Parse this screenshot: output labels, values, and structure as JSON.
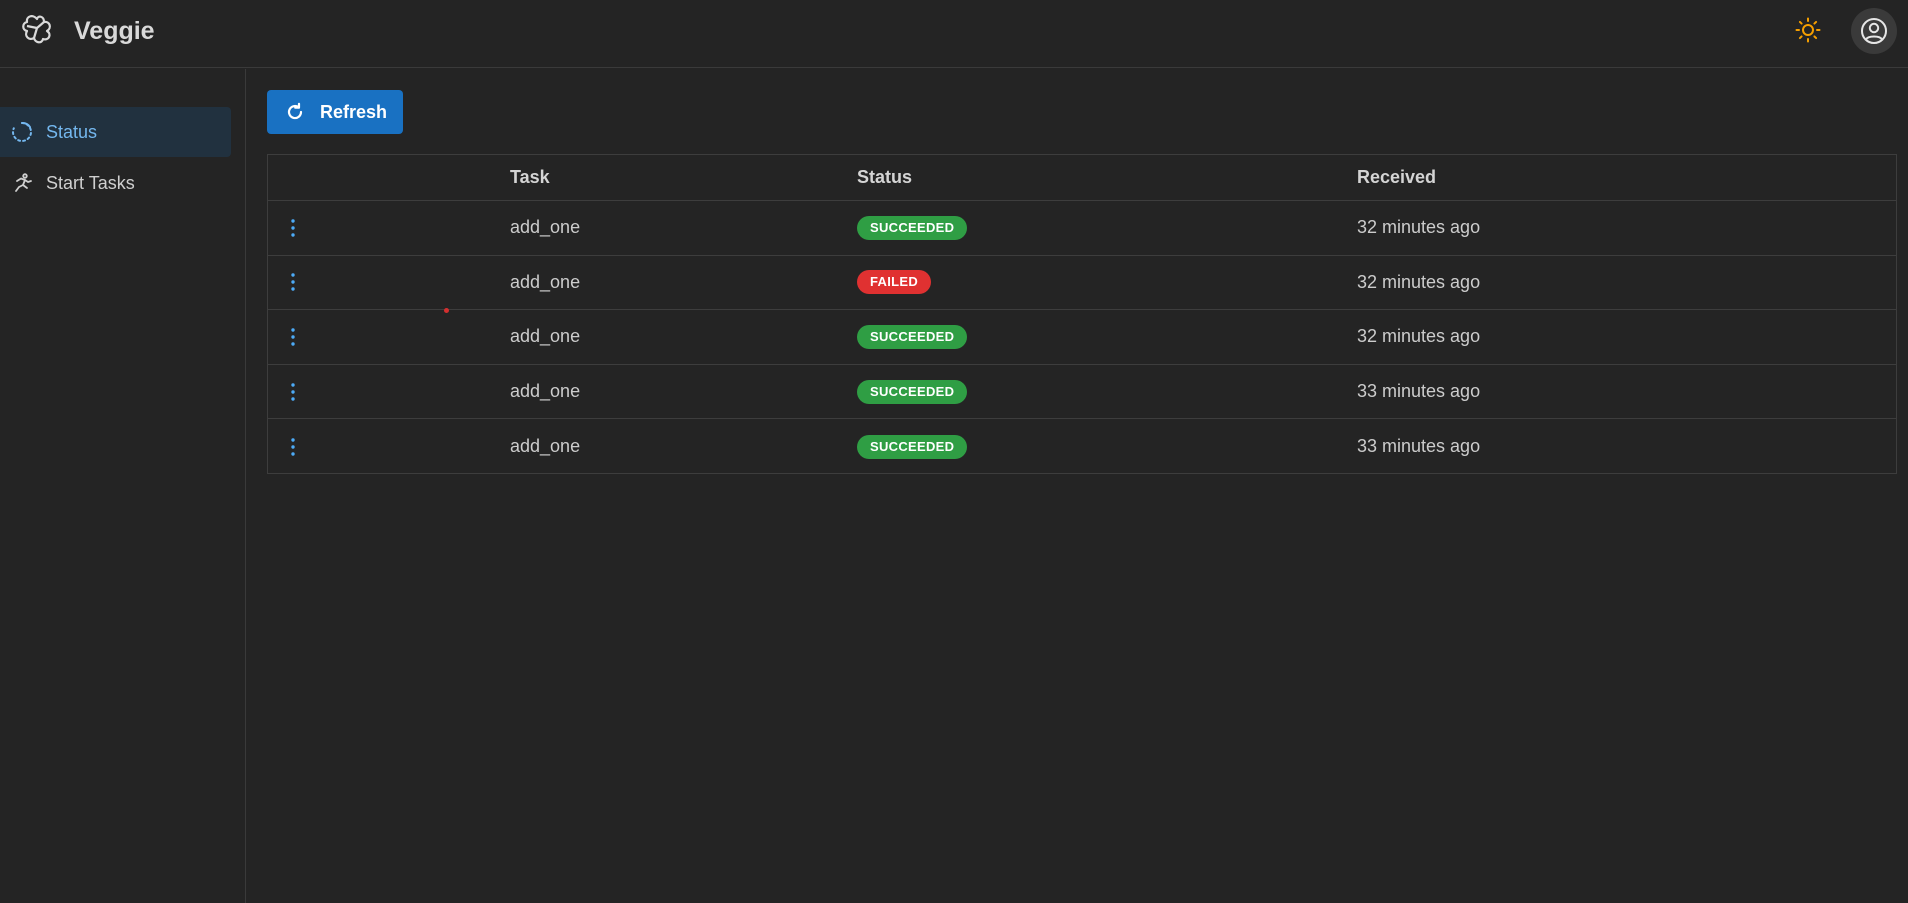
{
  "app": {
    "title": "Veggie"
  },
  "header": {
    "theme_icon": "sun-icon",
    "user_icon": "user-circle-icon"
  },
  "sidebar": {
    "items": [
      {
        "label": "Status",
        "icon": "loader-icon",
        "active": true
      },
      {
        "label": "Start Tasks",
        "icon": "run-icon",
        "active": false
      }
    ]
  },
  "toolbar": {
    "refresh_label": "Refresh",
    "refresh_icon": "refresh-icon"
  },
  "table": {
    "columns": [
      "",
      "Task",
      "Status",
      "Received"
    ],
    "rows": [
      {
        "task": "add_one",
        "status": "SUCCEEDED",
        "received": "32 minutes ago"
      },
      {
        "task": "add_one",
        "status": "FAILED",
        "received": "32 minutes ago"
      },
      {
        "task": "add_one",
        "status": "SUCCEEDED",
        "received": "32 minutes ago"
      },
      {
        "task": "add_one",
        "status": "SUCCEEDED",
        "received": "33 minutes ago"
      },
      {
        "task": "add_one",
        "status": "SUCCEEDED",
        "received": "33 minutes ago"
      }
    ]
  },
  "colors": {
    "success": "#2f9e44",
    "failed": "#e03131",
    "accent": "#1971c2",
    "sun": "#f59f00",
    "menu_dots": "#4dabf7"
  }
}
